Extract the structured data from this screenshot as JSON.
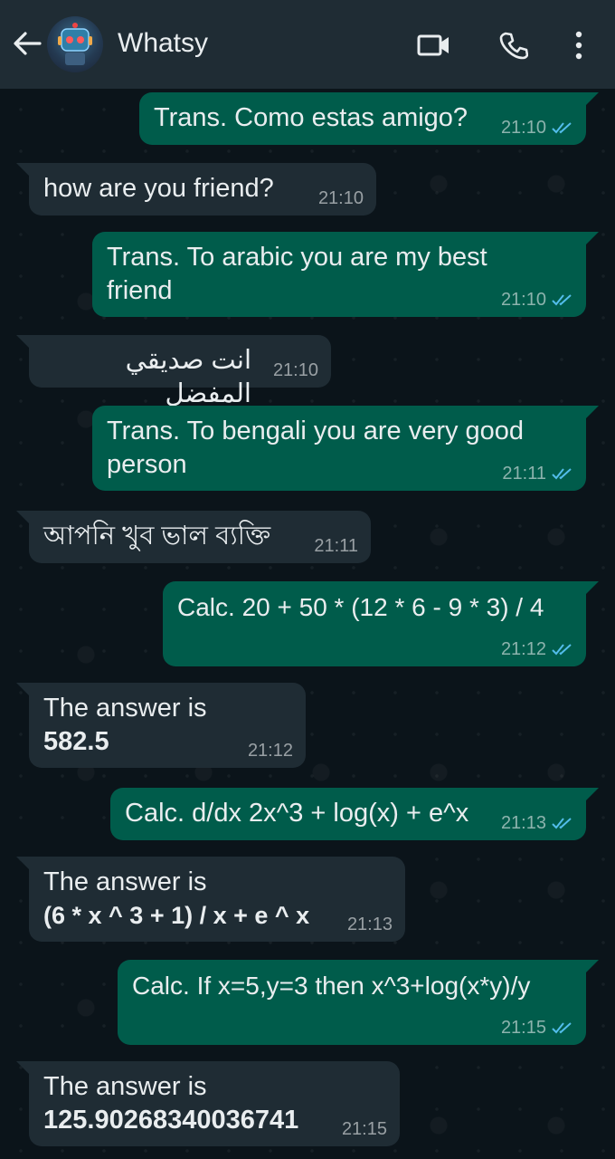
{
  "header": {
    "title": "Whatsy",
    "icons": [
      "back-arrow-icon",
      "video-call-icon",
      "phone-icon",
      "more-vertical-icon"
    ]
  },
  "colors": {
    "header_bg": "#1f2c34",
    "chat_bg": "#0b141a",
    "outgoing_bubble": "#005c4b",
    "incoming_bubble": "#1f2c34",
    "read_ticks": "#53bdeb"
  },
  "messages": [
    {
      "dir": "out",
      "lines": [
        "Trans. Como estas amigo?"
      ],
      "time": "21:10",
      "read": true
    },
    {
      "dir": "in",
      "lines": [
        "how are you friend?"
      ],
      "time": "21:10"
    },
    {
      "dir": "out",
      "lines": [
        "Trans. To arabic you are my best",
        "friend"
      ],
      "time": "21:10",
      "read": true
    },
    {
      "dir": "in",
      "lines": [
        "انت صديقي المفضل"
      ],
      "time": "21:10"
    },
    {
      "dir": "out",
      "lines": [
        "Trans. To bengali you are very good",
        "person"
      ],
      "time": "21:11",
      "read": true
    },
    {
      "dir": "in",
      "lines": [
        "আপনি খুব ভাল ব্যক্তি"
      ],
      "time": "21:11"
    },
    {
      "dir": "out",
      "lines": [
        "Calc. 20 + 50 * (12 * 6 - 9 * 3) / 4"
      ],
      "time": "21:12",
      "read": true
    },
    {
      "dir": "in",
      "lines": [
        "The answer is",
        "582.5"
      ],
      "time": "21:12"
    },
    {
      "dir": "out",
      "lines": [
        "Calc. d/dx 2x^3 + log(x) + e^x"
      ],
      "time": "21:13",
      "read": true
    },
    {
      "dir": "in",
      "lines": [
        "The answer is",
        "(6 * x ^ 3 + 1) / x + e ^ x"
      ],
      "time": "21:13"
    },
    {
      "dir": "out",
      "lines": [
        "Calc. If x=5,y=3 then x^3+log(x*y)/y"
      ],
      "time": "21:15",
      "read": true
    },
    {
      "dir": "in",
      "lines": [
        "The answer is",
        "125.90268340036741"
      ],
      "time": "21:15"
    }
  ]
}
